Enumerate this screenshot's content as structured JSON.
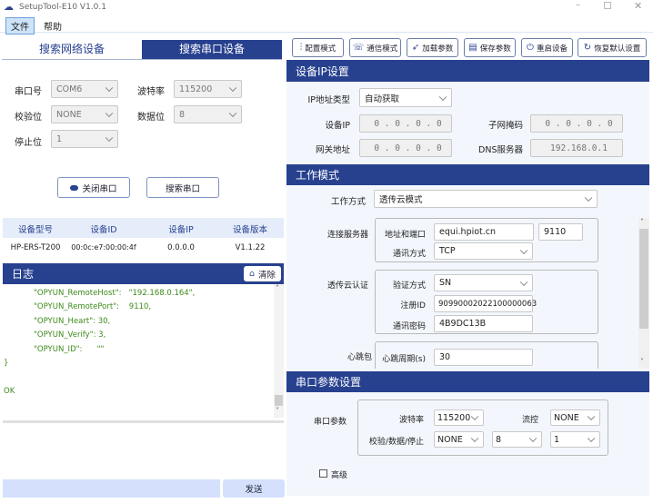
{
  "window": {
    "title": "SetupTool-E10 V1.0.1"
  },
  "menu": [
    "文件",
    "帮助"
  ],
  "left": {
    "tabs": [
      "搜索网络设备",
      "搜索串口设备"
    ],
    "serial": {
      "port_label": "串口号",
      "port": "COM6",
      "baud_label": "波特率",
      "baud": "115200",
      "parity_label": "校验位",
      "parity": "NONE",
      "data_label": "数据位",
      "data": "8",
      "stop_label": "停止位",
      "stop": "1"
    },
    "buttons": {
      "close": "关闭串口",
      "search": "搜索串口"
    },
    "table": {
      "headers": [
        "设备型号",
        "设备ID",
        "设备IP",
        "设备版本"
      ],
      "rows": [
        [
          "HP-ERS-T200",
          "00:0c:e7:00:00:4f",
          "0.0.0.0",
          "V1.1.22"
        ]
      ]
    },
    "log": {
      "title": "日志",
      "clear": "清除",
      "lines": [
        "\"OPYUN_RemoteHost\":   \"192.168.0.164\",",
        "\"OPYUN_RemotePort\":    9110,",
        "\"OPYUN_Heart\": 30,",
        "\"OPYUN_Verify\": 3,",
        "\"OPYUN_ID\":      \"\""
      ],
      "close_brace": "}",
      "status": "OK"
    },
    "send": "发送"
  },
  "toolbar": [
    "配置模式",
    "通信模式",
    "加载参数",
    "保存参数",
    "重启设备",
    "恢复默认设置"
  ],
  "ip": {
    "title": "设备IP设置",
    "type_label": "IP地址类型",
    "type": "自动获取",
    "ip_label": "设备IP",
    "ip": "0 . 0 . 0 . 0",
    "mask_label": "子网掩码",
    "mask": "0 . 0 . 0 . 0",
    "gw_label": "网关地址",
    "gw": "0 . 0 . 0 . 0",
    "dns_label": "DNS服务器",
    "dns": "192.168.0.1"
  },
  "work": {
    "title": "工作模式",
    "mode_label": "工作方式",
    "mode": "透传云模式",
    "server": {
      "label": "连接服务器",
      "addr_label": "地址和端口",
      "addr": "equi.hpiot.cn",
      "port": "9110",
      "proto_label": "通讯方式",
      "proto": "TCP"
    },
    "auth": {
      "label": "透传云认证",
      "method_label": "验证方式",
      "method": "SN",
      "id_label": "注册ID",
      "id": "90990002022100000063",
      "pwd_label": "通讯密码",
      "pwd": "4B9DC13B"
    },
    "heart": {
      "label": "心跳包",
      "period_label": "心跳周期(s)",
      "period": "30"
    }
  },
  "uart": {
    "title": "串口参数设置",
    "label": "串口参数",
    "baud_label": "波特率",
    "baud": "115200",
    "flow_label": "流控",
    "flow": "NONE",
    "pds_label": "校验/数据/停止",
    "parity": "NONE",
    "data": "8",
    "stop": "1",
    "advanced": "高级"
  }
}
